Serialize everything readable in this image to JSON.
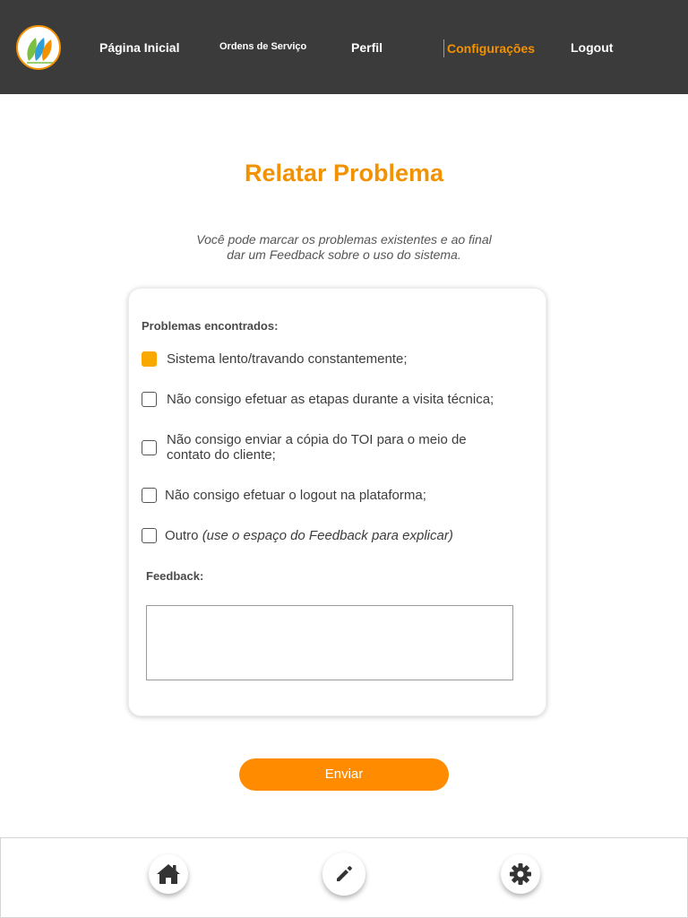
{
  "nav": {
    "home": "Página Inicial",
    "orders": "Ordens de Serviço",
    "profile": "Perfil",
    "settings": "Configurações",
    "logout": "Logout"
  },
  "page": {
    "title": "Relatar Problema",
    "subtitle": "Você pode marcar os problemas existentes e ao final dar um Feedback sobre o uso do sistema."
  },
  "form": {
    "problems_label": "Problemas encontrados:",
    "options": [
      {
        "label": "Sistema lento/travando constantemente;",
        "checked": true
      },
      {
        "label": "Não consigo efetuar as etapas durante a visita técnica;",
        "checked": false
      },
      {
        "label": "Não consigo enviar a cópia do TOI para o meio de contato do cliente;",
        "checked": false
      },
      {
        "label": "Não consigo efetuar o logout na plataforma;",
        "checked": false
      },
      {
        "label": "Outro",
        "note": "(use o espaço do Feedback para explicar)",
        "checked": false
      }
    ],
    "feedback_label": "Feedback:",
    "feedback_value": ""
  },
  "submit_label": "Enviar",
  "bottom_nav": {
    "icons": [
      "home-icon",
      "pencil-icon",
      "gear-icon"
    ]
  },
  "colors": {
    "accent": "#f39200",
    "checkbox_checked": "#f9a800",
    "button": "#ff8c00",
    "topbar": "#3b3b3b"
  }
}
